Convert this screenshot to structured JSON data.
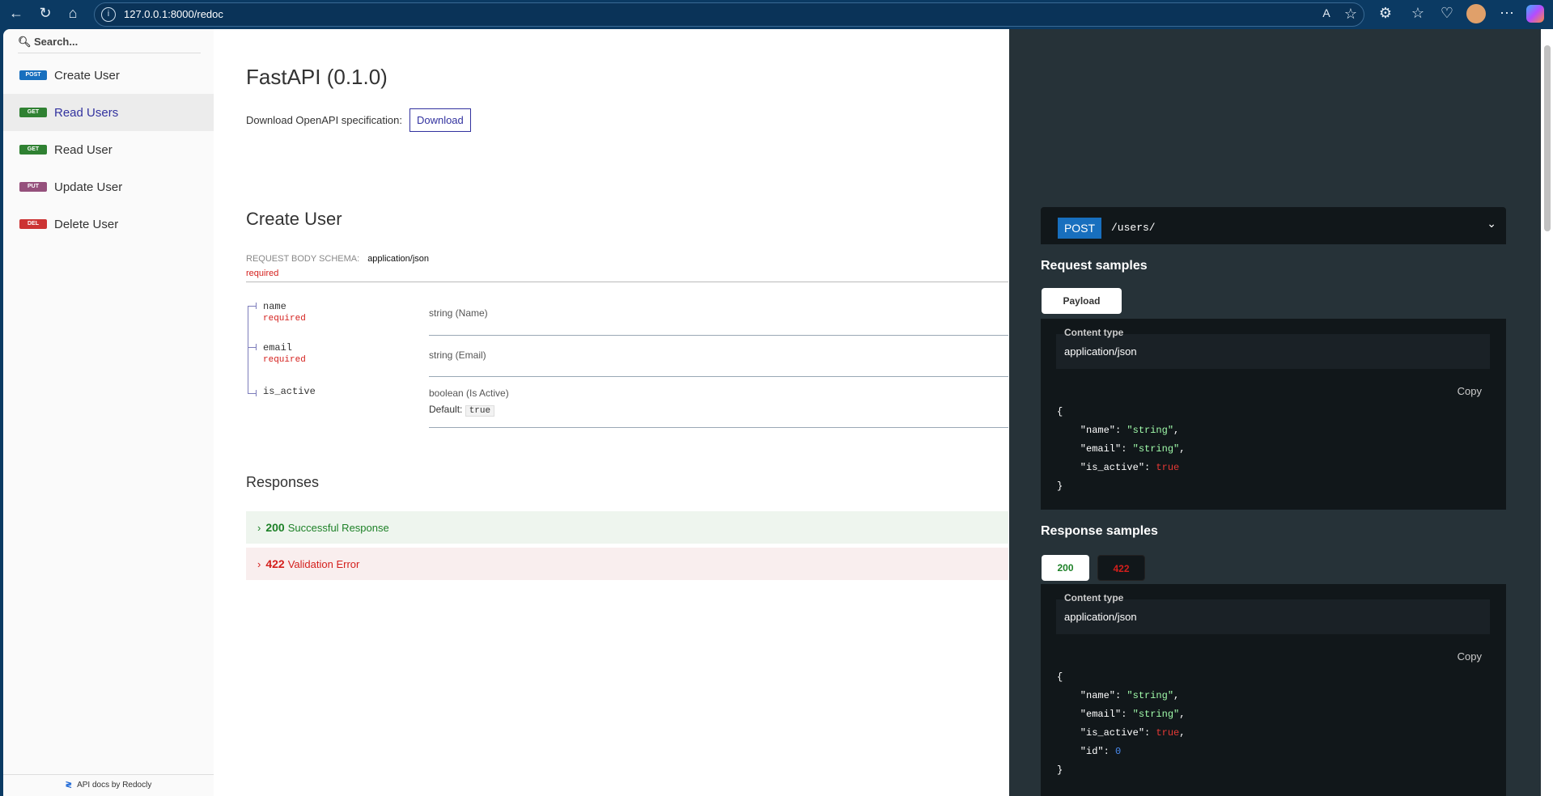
{
  "browser": {
    "url": "127.0.0.1:8000/redoc"
  },
  "sidebar": {
    "search_placeholder": "Search...",
    "items": [
      {
        "method": "POST",
        "label": "Create User",
        "color": "#186fbe"
      },
      {
        "method": "GET",
        "label": "Read Users",
        "color": "#2f8132"
      },
      {
        "method": "GET",
        "label": "Read User",
        "color": "#2f8132"
      },
      {
        "method": "PUT",
        "label": "Update User",
        "color": "#95507c"
      },
      {
        "method": "DEL",
        "label": "Delete User",
        "color": "#cc3333"
      }
    ],
    "footer": "API docs by Redocly"
  },
  "main": {
    "title": "FastAPI (0.1.0)",
    "download_text": "Download OpenAPI specification:",
    "download_button": "Download",
    "operation_title": "Create User",
    "request_body_label": "REQUEST BODY SCHEMA:",
    "request_body_type": "application/json",
    "required": "required",
    "fields": [
      {
        "name": "name",
        "required": "required",
        "type": "string (Name)"
      },
      {
        "name": "email",
        "required": "required",
        "type": "string (Email)"
      },
      {
        "name": "is_active",
        "type": "boolean (Is Active)",
        "default_label": "Default:",
        "default": "true"
      }
    ],
    "responses_title": "Responses",
    "responses": [
      {
        "code": "200",
        "label": "Successful Response"
      },
      {
        "code": "422",
        "label": "Validation Error"
      }
    ]
  },
  "right": {
    "method": "POST",
    "path": "/users/",
    "request_samples": "Request samples",
    "payload_tab": "Payload",
    "content_type_label": "Content type",
    "content_type": "application/json",
    "copy": "Copy",
    "response_samples": "Response samples",
    "response_tabs": [
      "200",
      "422"
    ]
  }
}
